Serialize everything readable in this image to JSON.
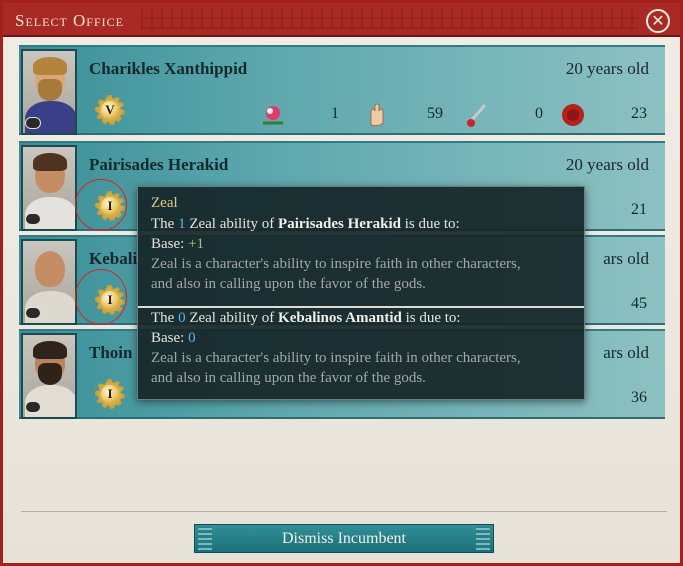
{
  "window": {
    "title": "Select Office",
    "close_icon": "close-icon"
  },
  "candidates": [
    {
      "name": "Charikles Xanthippid",
      "age": "20 years old",
      "ability_rank": "V",
      "stats": {
        "charisma": "1",
        "finesse": "59",
        "martial": "0",
        "zeal": "23"
      }
    },
    {
      "name": "Pairisades Herakid",
      "age": "20 years old",
      "ability_rank": "I",
      "stats": {
        "zeal": "21"
      }
    },
    {
      "name": "Kebali",
      "age": "ars old",
      "ability_rank": "I",
      "stats": {
        "zeal": "45"
      }
    },
    {
      "name": "Thoin",
      "age": "ars old",
      "ability_rank": "I",
      "stats": {
        "zeal": "36"
      }
    }
  ],
  "tooltip": {
    "title": "Zeal",
    "entry1": {
      "pre": "The ",
      "num": "1",
      "mid": " Zeal ability of ",
      "who": "Pairisades Herakid",
      "post": " is due to:",
      "base_label": "Base: ",
      "base_value": "+1",
      "desc1": "Zeal is a character's ability to inspire faith in other characters,",
      "desc2": "and also in calling upon the favor of the gods."
    },
    "entry2": {
      "pre": "The ",
      "num": "0",
      "mid": " Zeal ability of ",
      "who": "Kebalinos Amantid",
      "post": " is due to:",
      "base_label": "Base: ",
      "base_value": "0",
      "desc1": "Zeal is a character's ability to inspire faith in other characters,",
      "desc2": "and also in calling upon the favor of the gods."
    }
  },
  "footer": {
    "dismiss_label": "Dismiss Incumbent"
  },
  "colors": {
    "title_bar": "#a92a24",
    "row": "#5ea8ae",
    "accent_blue": "#5fb1e3",
    "accent_green": "#8fce6b"
  }
}
